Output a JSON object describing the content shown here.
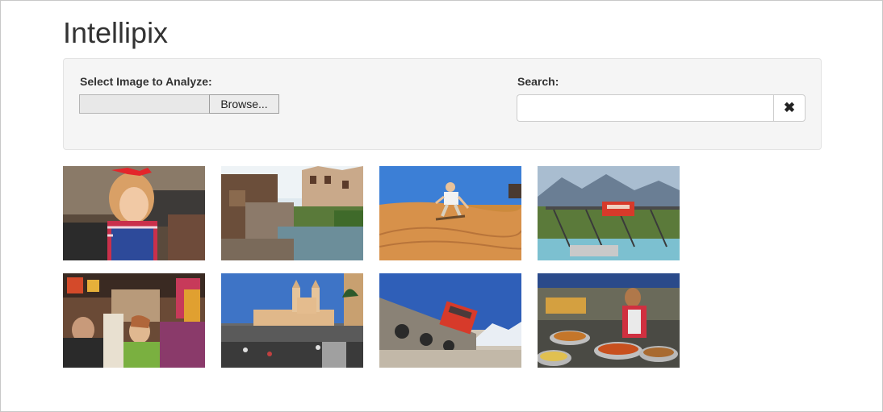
{
  "app": {
    "title": "Intellipix"
  },
  "upload": {
    "label": "Select Image to Analyze:",
    "browse_label": "Browse..."
  },
  "search": {
    "label": "Search:",
    "value": "",
    "placeholder": "",
    "clear_icon": "times-icon",
    "clear_glyph": "✖"
  },
  "gallery": [
    {
      "name": "girl-red-bow"
    },
    {
      "name": "canal-village"
    },
    {
      "name": "desert-sandboarder"
    },
    {
      "name": "red-train-bridge"
    },
    {
      "name": "crowded-market-street"
    },
    {
      "name": "church-steps"
    },
    {
      "name": "mountain-railway"
    },
    {
      "name": "food-market-vendor"
    }
  ]
}
